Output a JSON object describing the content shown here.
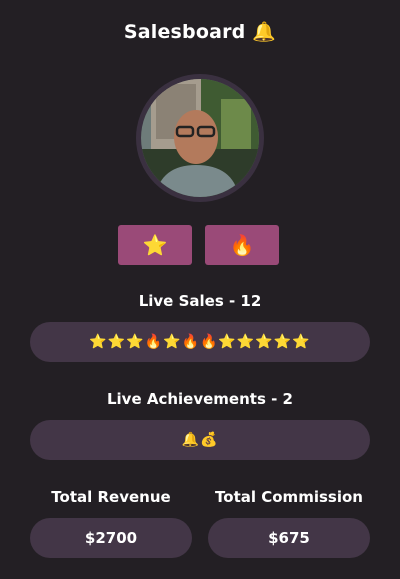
{
  "header": {
    "title": "Salesboard 🔔"
  },
  "profile": {
    "avatar_alt": "avatar"
  },
  "actions": {
    "star_label": "⭐",
    "fire_label": "🔥"
  },
  "live_sales": {
    "label": "Live Sales - 12",
    "icons": "⭐⭐⭐🔥⭐🔥🔥⭐⭐⭐⭐⭐"
  },
  "live_achievements": {
    "label": "Live Achievements - 2",
    "icons": "🔔💰"
  },
  "stats": {
    "revenue_label": "Total Revenue",
    "revenue_value": "$2700",
    "commission_label": "Total Commission",
    "commission_value": "$675"
  },
  "colors": {
    "background": "#231f24",
    "pill": "#433647",
    "button": "#9a4a78"
  }
}
